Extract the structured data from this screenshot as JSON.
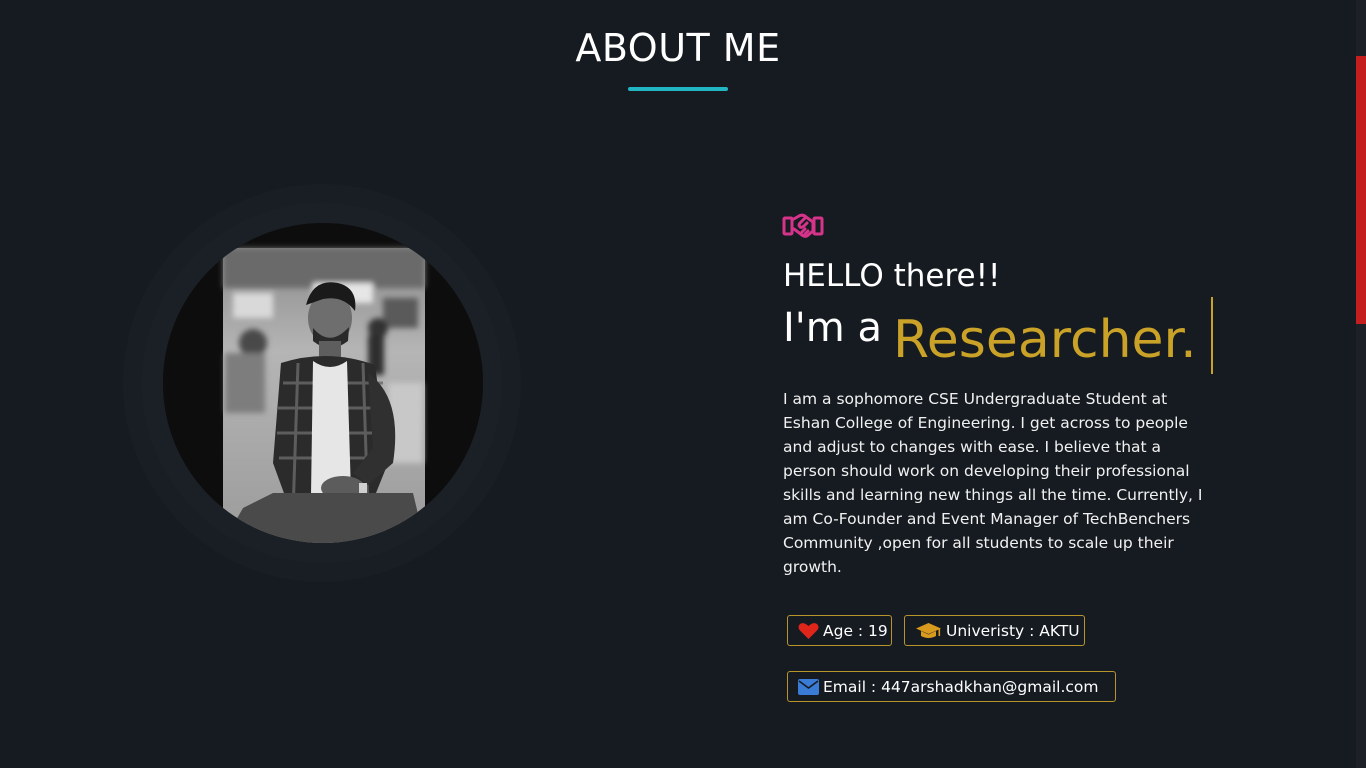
{
  "section": {
    "title": "ABOUT ME",
    "accent_color": "#22b5c3"
  },
  "photo": {
    "alt": "profile-photo-grayscale"
  },
  "intro": {
    "icon": "handshake-icon",
    "icon_color": "#d6338a",
    "greeting": "HELLO there!!",
    "prefix": "I'm a",
    "role": "Researcher.",
    "role_color": "#c9a227"
  },
  "bio": "I am a sophomore CSE Undergraduate Student at Eshan College of Engineering. I get across to people and adjust to changes with ease. I believe that a person should work on developing their professional skills and learning new things all the time. Currently, I am Co-Founder and Event Manager of TechBenchers Community ,open for all students to scale up their growth.",
  "info": {
    "age": {
      "icon": "heart-icon",
      "label": "Age : 19",
      "icon_color": "#e0261b"
    },
    "university": {
      "icon": "graduation-cap-icon",
      "label": "Univeristy : AKTU",
      "icon_color": "#d99a1e"
    },
    "email": {
      "icon": "envelope-icon",
      "label": "Email : 447arshadkhan@gmail.com",
      "icon_color": "#3a7bd5"
    }
  },
  "scrollbar": {
    "thumb_color": "#c41e1e"
  }
}
